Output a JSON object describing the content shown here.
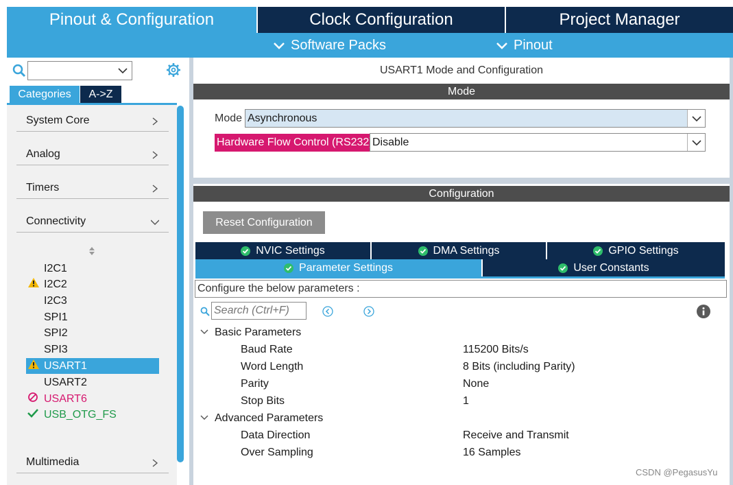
{
  "top_tabs": [
    {
      "label": "Pinout & Configuration",
      "active": true
    },
    {
      "label": "Clock Configuration",
      "active": false
    },
    {
      "label": "Project Manager",
      "active": false
    }
  ],
  "sub_menu": [
    {
      "label": "Software Packs"
    },
    {
      "label": "Pinout"
    }
  ],
  "left": {
    "search": {
      "value": ""
    },
    "tabs": [
      {
        "label": "Categories",
        "active": true
      },
      {
        "label": "A->Z",
        "active": false
      }
    ],
    "categories": [
      {
        "label": "System Core",
        "expanded": false
      },
      {
        "label": "Analog",
        "expanded": false
      },
      {
        "label": "Timers",
        "expanded": false
      },
      {
        "label": "Connectivity",
        "expanded": true
      },
      {
        "label": "Multimedia",
        "expanded": false
      }
    ],
    "peripherals": [
      {
        "label": "I2C1",
        "status": "none"
      },
      {
        "label": "I2C2",
        "status": "warning"
      },
      {
        "label": "I2C3",
        "status": "none"
      },
      {
        "label": "SPI1",
        "status": "none"
      },
      {
        "label": "SPI2",
        "status": "none"
      },
      {
        "label": "SPI3",
        "status": "none"
      },
      {
        "label": "USART1",
        "status": "warning-selected"
      },
      {
        "label": "USART2",
        "status": "none"
      },
      {
        "label": "USART6",
        "status": "disabled"
      },
      {
        "label": "USB_OTG_FS",
        "status": "ok"
      }
    ]
  },
  "right": {
    "title": "USART1 Mode and Configuration",
    "mode_header": "Mode",
    "mode_label": "Mode",
    "mode_value": "Asynchronous",
    "hwfc_label": "Hardware Flow Control (RS232)",
    "hwfc_value": "Disable",
    "config_header": "Configuration",
    "reset_button": "Reset Configuration",
    "tabs_row1": [
      {
        "label": "NVIC Settings"
      },
      {
        "label": "DMA Settings"
      },
      {
        "label": "GPIO Settings"
      }
    ],
    "tabs_row2": [
      {
        "label": "Parameter Settings",
        "active": true
      },
      {
        "label": "User Constants",
        "active": false
      }
    ],
    "configure_text": "Configure the below parameters :",
    "search_placeholder": "Search (Ctrl+F)",
    "groups": [
      {
        "name": "Basic Parameters",
        "params": [
          {
            "name": "Baud Rate",
            "value": "115200 Bits/s"
          },
          {
            "name": "Word Length",
            "value": "8 Bits (including Parity)"
          },
          {
            "name": "Parity",
            "value": "None"
          },
          {
            "name": "Stop Bits",
            "value": "1"
          }
        ]
      },
      {
        "name": "Advanced Parameters",
        "params": [
          {
            "name": "Data Direction",
            "value": "Receive and Transmit"
          },
          {
            "name": "Over Sampling",
            "value": "16 Samples"
          }
        ]
      }
    ]
  },
  "watermark": "CSDN @PegasusYu",
  "colors": {
    "accent": "#3aa5db",
    "navy": "#0d2a4d",
    "header_gray": "#4d4d4d",
    "warning": "#f2b705",
    "error_magenta": "#d6186f",
    "ok_green": "#1f9a4a",
    "mode_field_bg": "#d6e6f3"
  }
}
